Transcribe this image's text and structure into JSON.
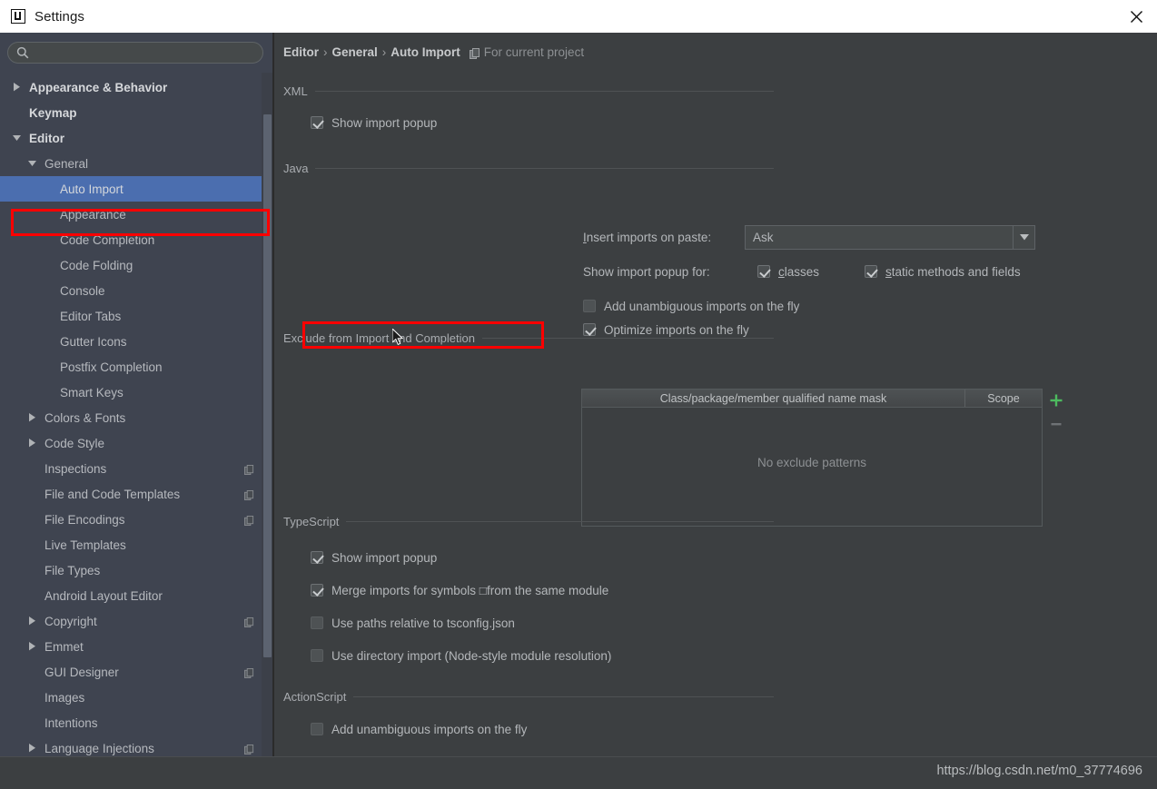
{
  "window": {
    "title": "Settings",
    "logo_icon": "intellij-idea-logo-icon",
    "close_icon": "close-icon"
  },
  "sidebar": {
    "search": {
      "value": "",
      "placeholder": "",
      "icon": "search-icon"
    },
    "items": [
      {
        "label": "Appearance & Behavior",
        "indent": 0,
        "arrow": "right",
        "bold": true,
        "badge": false,
        "selected": false
      },
      {
        "label": "Keymap",
        "indent": 0,
        "arrow": "none",
        "bold": true,
        "badge": false,
        "selected": false
      },
      {
        "label": "Editor",
        "indent": 0,
        "arrow": "down",
        "bold": true,
        "badge": false,
        "selected": false
      },
      {
        "label": "General",
        "indent": 1,
        "arrow": "down",
        "bold": false,
        "badge": false,
        "selected": false
      },
      {
        "label": "Auto Import",
        "indent": 2,
        "arrow": "none",
        "bold": false,
        "badge": false,
        "selected": true
      },
      {
        "label": "Appearance",
        "indent": 2,
        "arrow": "none",
        "bold": false,
        "badge": false,
        "selected": false
      },
      {
        "label": "Code Completion",
        "indent": 2,
        "arrow": "none",
        "bold": false,
        "badge": false,
        "selected": false
      },
      {
        "label": "Code Folding",
        "indent": 2,
        "arrow": "none",
        "bold": false,
        "badge": false,
        "selected": false
      },
      {
        "label": "Console",
        "indent": 2,
        "arrow": "none",
        "bold": false,
        "badge": false,
        "selected": false
      },
      {
        "label": "Editor Tabs",
        "indent": 2,
        "arrow": "none",
        "bold": false,
        "badge": false,
        "selected": false
      },
      {
        "label": "Gutter Icons",
        "indent": 2,
        "arrow": "none",
        "bold": false,
        "badge": false,
        "selected": false
      },
      {
        "label": "Postfix Completion",
        "indent": 2,
        "arrow": "none",
        "bold": false,
        "badge": false,
        "selected": false
      },
      {
        "label": "Smart Keys",
        "indent": 2,
        "arrow": "none",
        "bold": false,
        "badge": false,
        "selected": false
      },
      {
        "label": "Colors & Fonts",
        "indent": 1,
        "arrow": "right",
        "bold": false,
        "badge": false,
        "selected": false
      },
      {
        "label": "Code Style",
        "indent": 1,
        "arrow": "right",
        "bold": false,
        "badge": false,
        "selected": false
      },
      {
        "label": "Inspections",
        "indent": 1,
        "arrow": "none",
        "bold": false,
        "badge": true,
        "selected": false
      },
      {
        "label": "File and Code Templates",
        "indent": 1,
        "arrow": "none",
        "bold": false,
        "badge": true,
        "selected": false
      },
      {
        "label": "File Encodings",
        "indent": 1,
        "arrow": "none",
        "bold": false,
        "badge": true,
        "selected": false
      },
      {
        "label": "Live Templates",
        "indent": 1,
        "arrow": "none",
        "bold": false,
        "badge": false,
        "selected": false
      },
      {
        "label": "File Types",
        "indent": 1,
        "arrow": "none",
        "bold": false,
        "badge": false,
        "selected": false
      },
      {
        "label": "Android Layout Editor",
        "indent": 1,
        "arrow": "none",
        "bold": false,
        "badge": false,
        "selected": false
      },
      {
        "label": "Copyright",
        "indent": 1,
        "arrow": "right",
        "bold": false,
        "badge": true,
        "selected": false
      },
      {
        "label": "Emmet",
        "indent": 1,
        "arrow": "right",
        "bold": false,
        "badge": false,
        "selected": false
      },
      {
        "label": "GUI Designer",
        "indent": 1,
        "arrow": "none",
        "bold": false,
        "badge": true,
        "selected": false
      },
      {
        "label": "Images",
        "indent": 1,
        "arrow": "none",
        "bold": false,
        "badge": false,
        "selected": false
      },
      {
        "label": "Intentions",
        "indent": 1,
        "arrow": "none",
        "bold": false,
        "badge": false,
        "selected": false
      },
      {
        "label": "Language Injections",
        "indent": 1,
        "arrow": "right",
        "bold": false,
        "badge": true,
        "selected": false
      }
    ]
  },
  "breadcrumb": {
    "crumbs": [
      "Editor",
      "General",
      "Auto Import"
    ],
    "separator": "›",
    "project_icon": "copy-project-scope-icon",
    "scope_note": "For current project"
  },
  "sections": {
    "xml": {
      "title": "XML",
      "options": [
        {
          "label": "Show import popup",
          "checked": true
        }
      ]
    },
    "java": {
      "title": "Java",
      "combo": {
        "label": "Insert imports on paste:",
        "mnemonic": "I",
        "value": "Ask",
        "arrow_icon": "chevron-down-icon"
      },
      "popup_for": {
        "label": "Show import popup for:",
        "options": [
          {
            "label": "classes",
            "mnemonic": "c",
            "checked": true
          },
          {
            "label": "static methods and fields",
            "mnemonic": "s",
            "checked": true
          }
        ]
      },
      "options": [
        {
          "label": "Add unambiguous imports on the fly",
          "checked": false
        },
        {
          "label": "Optimize imports on the fly",
          "checked": true
        }
      ]
    },
    "exclude": {
      "title": "Exclude from Import and Completion",
      "columns": [
        "Class/package/member qualified name mask",
        "Scope"
      ],
      "rows": [],
      "empty_text": "No exclude patterns",
      "add_label": "+",
      "remove_label": "–",
      "add_icon": "plus-icon",
      "remove_icon": "minus-icon"
    },
    "typescript": {
      "title": "TypeScript",
      "options": [
        {
          "label": "Show import popup",
          "checked": true
        },
        {
          "label": "Merge imports for symbols □from the same module",
          "checked": true
        },
        {
          "label": "Use paths relative to tsconfig.json",
          "checked": false
        },
        {
          "label": "Use directory import (Node-style module resolution)",
          "checked": false
        }
      ]
    },
    "actionscript": {
      "title": "ActionScript",
      "options": [
        {
          "label": "Add unambiguous imports on the fly",
          "checked": false
        }
      ]
    }
  },
  "footer": {
    "watermark": "https://blog.csdn.net/m0_37774696"
  },
  "colors": {
    "selection_blue": "#4B6EAF",
    "highlight_red": "#FF0000",
    "panel_bg": "#3C3F41",
    "sidebar_bg": "#3F4450",
    "add_green": "#4DBB5F"
  }
}
